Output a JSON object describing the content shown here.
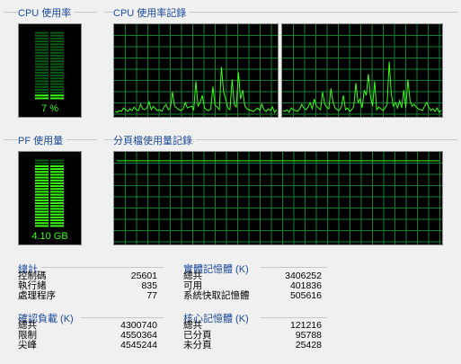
{
  "cpu": {
    "usage_title": "CPU 使用率",
    "usage_value": "7 %",
    "usage_fraction": 0.07,
    "history_title": "CPU 使用率記錄",
    "history": [
      [
        4,
        3,
        5,
        4,
        8,
        6,
        4,
        7,
        5,
        9,
        6,
        5,
        12,
        7,
        6,
        8,
        15,
        6,
        10,
        7,
        5,
        6,
        4,
        9,
        12,
        6,
        8,
        26,
        10,
        8,
        6,
        5,
        7,
        14,
        8,
        9,
        10,
        6,
        38,
        10,
        14,
        22,
        8,
        6,
        5,
        7,
        32,
        11,
        9,
        6,
        54,
        26,
        18,
        8,
        6,
        40,
        12,
        9,
        48,
        18,
        28,
        10,
        7,
        6,
        5,
        4,
        6,
        8,
        5,
        12,
        6,
        4,
        7,
        5,
        9,
        3,
        6
      ],
      [
        5,
        4,
        6,
        3,
        8,
        6,
        5,
        4,
        7,
        12,
        8,
        6,
        9,
        14,
        7,
        18,
        10,
        8,
        6,
        26,
        12,
        9,
        7,
        30,
        14,
        8,
        6,
        5,
        9,
        22,
        6,
        8,
        4,
        6,
        10,
        36,
        14,
        18,
        8,
        28,
        22,
        46,
        20,
        10,
        38,
        6,
        9,
        7,
        5,
        8,
        12,
        60,
        24,
        10,
        14,
        8,
        16,
        8,
        28,
        8,
        40,
        16,
        10,
        12,
        9,
        7,
        6,
        5,
        10,
        14,
        9,
        5,
        7,
        4,
        8,
        3,
        5
      ]
    ]
  },
  "pf": {
    "usage_title": "PF 使用量",
    "usage_value": "4.10 GB",
    "usage_fraction": 0.92,
    "history_title": "分頁檔使用量記錄",
    "history_level": 0.92
  },
  "totals": {
    "title": "總計",
    "rows": [
      {
        "label": "控制碼",
        "value": "25601"
      },
      {
        "label": "執行緒",
        "value": "835"
      },
      {
        "label": "處理程序",
        "value": "77"
      }
    ]
  },
  "commit": {
    "title": "確認負載 (K)",
    "rows": [
      {
        "label": "總共",
        "value": "4300740"
      },
      {
        "label": "限制",
        "value": "4550364"
      },
      {
        "label": "尖峰",
        "value": "4545244"
      }
    ]
  },
  "physical": {
    "title": "實體記憶體 (K)",
    "rows": [
      {
        "label": "總共",
        "value": "3406252"
      },
      {
        "label": "可用",
        "value": "401836"
      },
      {
        "label": "系統快取記憶體",
        "value": "505616"
      }
    ]
  },
  "kernel": {
    "title": "核心記憶體 (K)",
    "rows": [
      {
        "label": "總共",
        "value": "121216"
      },
      {
        "label": "已分頁",
        "value": "95788"
      },
      {
        "label": "未分頁",
        "value": "25428"
      }
    ]
  },
  "colors": {
    "graph_bg": "#000000",
    "grid": "#0f7f2f",
    "line": "#39ff14",
    "meter_dim": "#0a5c14",
    "meter_lit": "#39ff14",
    "title_blue": "#1a4a9c"
  }
}
